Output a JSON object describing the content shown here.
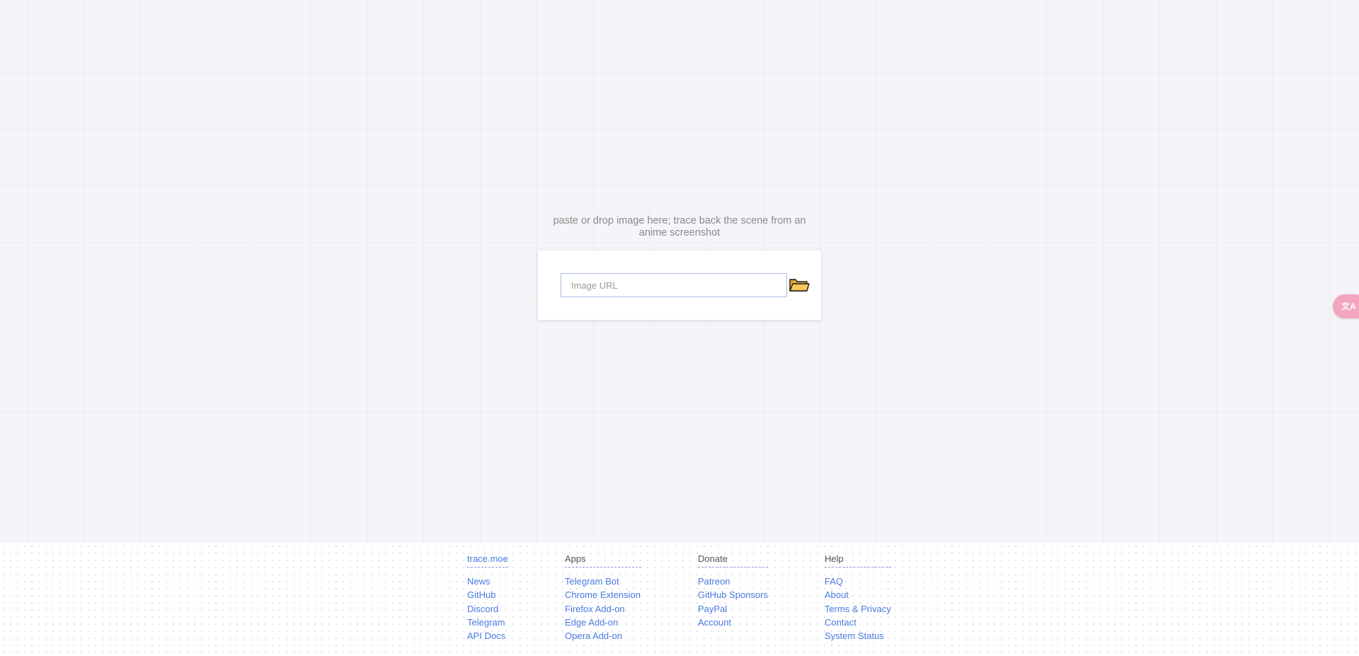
{
  "main": {
    "tagline": "paste or drop image here; trace back the scene from an anime screenshot",
    "search": {
      "placeholder": "Image URL",
      "value": ""
    },
    "upload_icon": "folder-icon",
    "language_icon": "translate-icon",
    "language_label": "文A"
  },
  "colors": {
    "background": "#f5f5f9",
    "link": "#4a7ae0",
    "folder": "#f7c85a",
    "language_button": "#f2a6bd"
  },
  "footer": {
    "columns": [
      {
        "heading": "trace.moe",
        "items": [
          "News",
          "GitHub",
          "Discord",
          "Telegram",
          "API Docs"
        ]
      },
      {
        "heading": "Apps",
        "items": [
          "Telegram Bot",
          "Chrome Extension",
          "Firefox Add-on",
          "Edge Add-on",
          "Opera Add-on"
        ]
      },
      {
        "heading": "Donate",
        "items": [
          "Patreon",
          "GitHub Sponsors",
          "PayPal",
          "Account"
        ]
      },
      {
        "heading": "Help",
        "items": [
          "FAQ",
          "About",
          "Terms & Privacy",
          "Contact",
          "System Status"
        ]
      }
    ]
  }
}
